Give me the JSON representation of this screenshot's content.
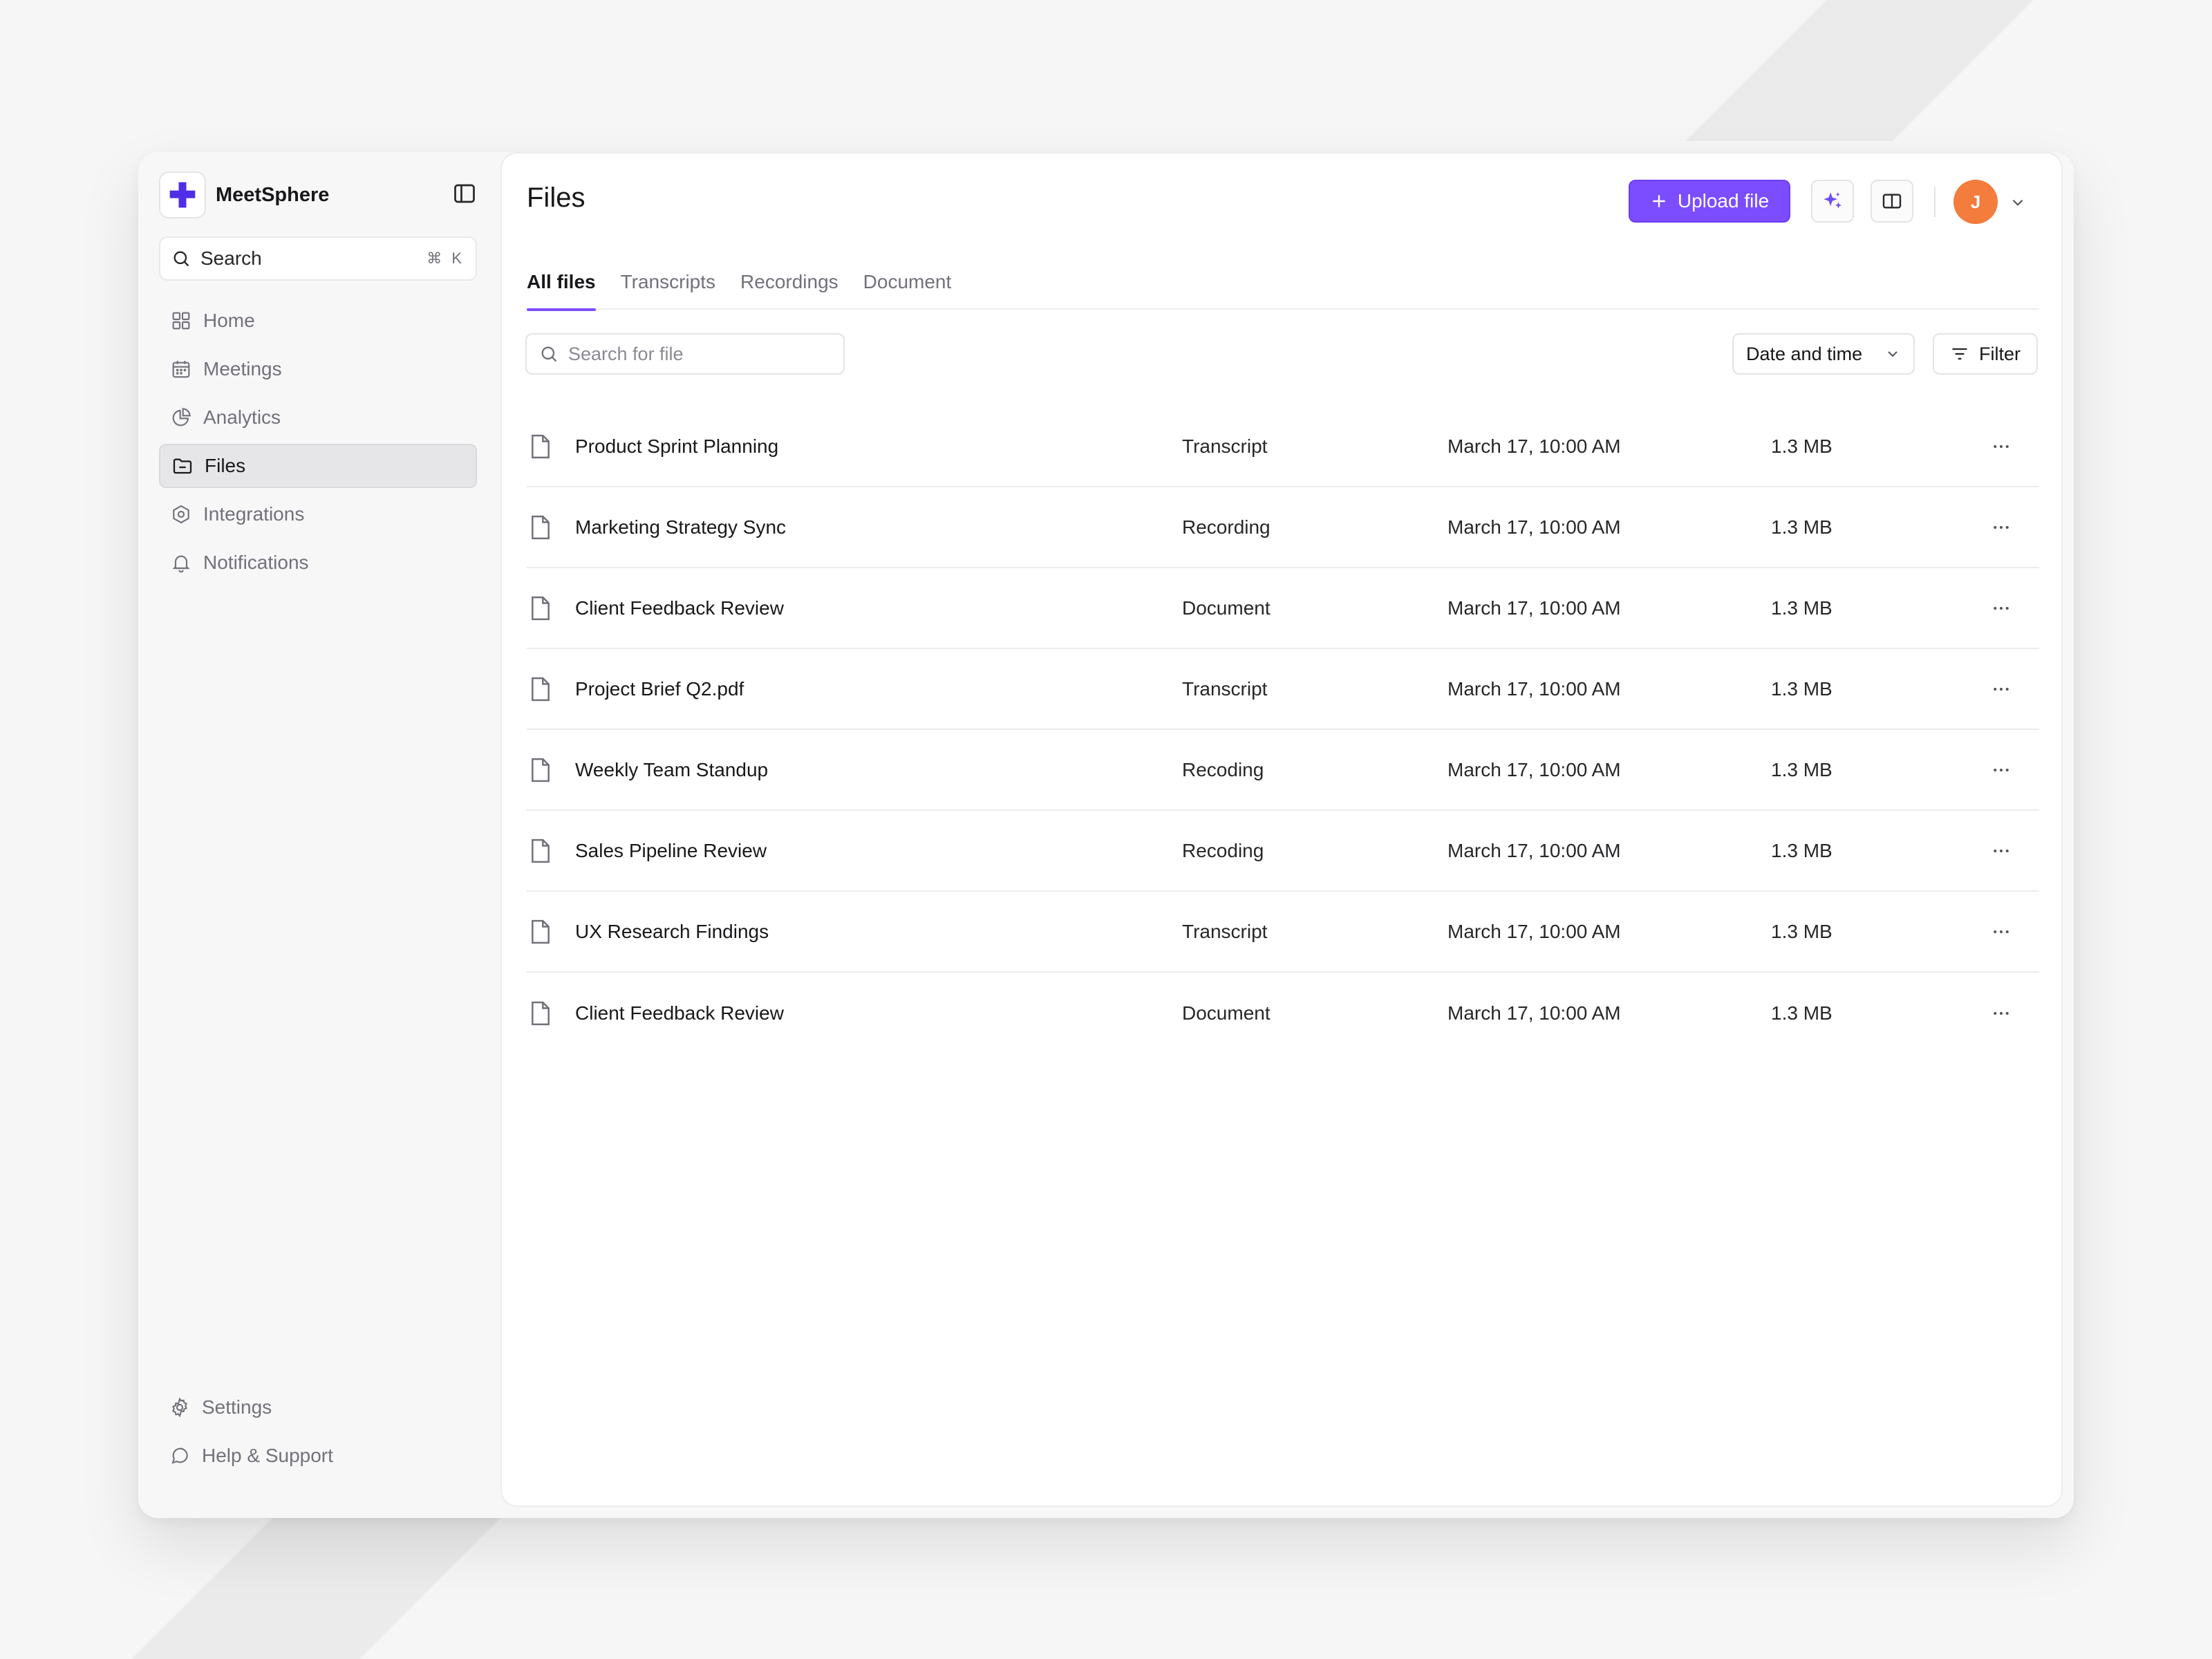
{
  "app": {
    "name": "MeetSphere",
    "brand_color": "#7c4dff"
  },
  "sidebar": {
    "search_label": "Search",
    "search_shortcut": "⌘ K",
    "items": [
      {
        "label": "Home",
        "icon": "grid-icon"
      },
      {
        "label": "Meetings",
        "icon": "calendar-icon"
      },
      {
        "label": "Analytics",
        "icon": "pie-chart-icon"
      },
      {
        "label": "Files",
        "icon": "folder-icon",
        "active": true
      },
      {
        "label": "Integrations",
        "icon": "hexagon-icon"
      },
      {
        "label": "Notifications",
        "icon": "bell-icon"
      }
    ],
    "bottom_items": [
      {
        "label": "Settings",
        "icon": "gear-icon"
      },
      {
        "label": "Help & Support",
        "icon": "chat-icon"
      }
    ]
  },
  "header": {
    "title": "Files",
    "upload_label": "Upload file",
    "avatar_initial": "J",
    "avatar_color": "#f47c3c"
  },
  "tabs": [
    {
      "label": "All files",
      "active": true
    },
    {
      "label": "Transcripts"
    },
    {
      "label": "Recordings"
    },
    {
      "label": "Document"
    }
  ],
  "toolbar": {
    "search_placeholder": "Search for file",
    "sort_label": "Date and time",
    "filter_label": "Filter"
  },
  "files": [
    {
      "name": "Product Sprint Planning",
      "type": "Transcript",
      "date": "March 17, 10:00 AM",
      "size": "1.3 MB"
    },
    {
      "name": "Marketing Strategy Sync",
      "type": "Recording",
      "date": "March 17, 10:00 AM",
      "size": "1.3 MB"
    },
    {
      "name": "Client Feedback Review",
      "type": "Document",
      "date": "March 17, 10:00 AM",
      "size": "1.3 MB"
    },
    {
      "name": "Project Brief Q2.pdf",
      "type": "Transcript",
      "date": "March 17, 10:00 AM",
      "size": "1.3 MB"
    },
    {
      "name": "Weekly Team Standup",
      "type": "Recoding",
      "date": "March 17, 10:00 AM",
      "size": "1.3 MB"
    },
    {
      "name": "Sales Pipeline Review",
      "type": "Recoding",
      "date": "March 17, 10:00 AM",
      "size": "1.3 MB"
    },
    {
      "name": "UX Research Findings",
      "type": "Transcript",
      "date": "March 17, 10:00 AM",
      "size": "1.3 MB"
    },
    {
      "name": "Client Feedback Review",
      "type": "Document",
      "date": "March 17, 10:00 AM",
      "size": "1.3 MB"
    }
  ]
}
